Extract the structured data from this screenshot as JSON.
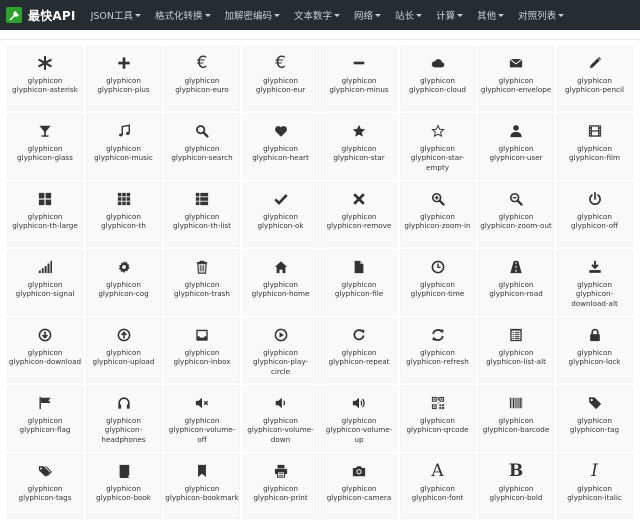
{
  "brand": {
    "title": "最快API"
  },
  "nav": [
    {
      "label": "JSON工具",
      "dropdown": true
    },
    {
      "label": "格式化转换",
      "dropdown": true
    },
    {
      "label": "加解密编码",
      "dropdown": true
    },
    {
      "label": "文本数字",
      "dropdown": true
    },
    {
      "label": "网络",
      "dropdown": true
    },
    {
      "label": "站长",
      "dropdown": true
    },
    {
      "label": "计算",
      "dropdown": true
    },
    {
      "label": "其他",
      "dropdown": true
    },
    {
      "label": "对照列表",
      "dropdown": true
    }
  ],
  "icons": [
    {
      "prefix": "glyphicon",
      "name": "glyphicon-asterisk",
      "icon": "asterisk-icon"
    },
    {
      "prefix": "glyphicon",
      "name": "glyphicon-plus",
      "icon": "plus-icon"
    },
    {
      "prefix": "glyphicon",
      "name": "glyphicon-euro",
      "icon": "euro-icon"
    },
    {
      "prefix": "glyphicon",
      "name": "glyphicon-eur",
      "icon": "eur-icon"
    },
    {
      "prefix": "glyphicon",
      "name": "glyphicon-minus",
      "icon": "minus-icon"
    },
    {
      "prefix": "glyphicon",
      "name": "glyphicon-cloud",
      "icon": "cloud-icon"
    },
    {
      "prefix": "glyphicon",
      "name": "glyphicon-envelope",
      "icon": "envelope-icon"
    },
    {
      "prefix": "glyphicon",
      "name": "glyphicon-pencil",
      "icon": "pencil-icon"
    },
    {
      "prefix": "glyphicon",
      "name": "glyphicon-glass",
      "icon": "glass-icon"
    },
    {
      "prefix": "glyphicon",
      "name": "glyphicon-music",
      "icon": "music-icon"
    },
    {
      "prefix": "glyphicon",
      "name": "glyphicon-search",
      "icon": "search-icon"
    },
    {
      "prefix": "glyphicon",
      "name": "glyphicon-heart",
      "icon": "heart-icon"
    },
    {
      "prefix": "glyphicon",
      "name": "glyphicon-star",
      "icon": "star-icon"
    },
    {
      "prefix": "glyphicon",
      "name": "glyphicon-star-empty",
      "icon": "star-empty-icon"
    },
    {
      "prefix": "glyphicon",
      "name": "glyphicon-user",
      "icon": "user-icon"
    },
    {
      "prefix": "glyphicon",
      "name": "glyphicon-film",
      "icon": "film-icon"
    },
    {
      "prefix": "glyphicon",
      "name": "glyphicon-th-large",
      "icon": "th-large-icon"
    },
    {
      "prefix": "glyphicon",
      "name": "glyphicon-th",
      "icon": "th-icon"
    },
    {
      "prefix": "glyphicon",
      "name": "glyphicon-th-list",
      "icon": "th-list-icon"
    },
    {
      "prefix": "glyphicon",
      "name": "glyphicon-ok",
      "icon": "ok-icon"
    },
    {
      "prefix": "glyphicon",
      "name": "glyphicon-remove",
      "icon": "remove-icon"
    },
    {
      "prefix": "glyphicon",
      "name": "glyphicon-zoom-in",
      "icon": "zoom-in-icon"
    },
    {
      "prefix": "glyphicon",
      "name": "glyphicon-zoom-out",
      "icon": "zoom-out-icon"
    },
    {
      "prefix": "glyphicon",
      "name": "glyphicon-off",
      "icon": "off-icon"
    },
    {
      "prefix": "glyphicon",
      "name": "glyphicon-signal",
      "icon": "signal-icon"
    },
    {
      "prefix": "glyphicon",
      "name": "glyphicon-cog",
      "icon": "cog-icon"
    },
    {
      "prefix": "glyphicon",
      "name": "glyphicon-trash",
      "icon": "trash-icon"
    },
    {
      "prefix": "glyphicon",
      "name": "glyphicon-home",
      "icon": "home-icon"
    },
    {
      "prefix": "glyphicon",
      "name": "glyphicon-file",
      "icon": "file-icon"
    },
    {
      "prefix": "glyphicon",
      "name": "glyphicon-time",
      "icon": "time-icon"
    },
    {
      "prefix": "glyphicon",
      "name": "glyphicon-road",
      "icon": "road-icon"
    },
    {
      "prefix": "glyphicon",
      "name": "glyphicon-download-alt",
      "icon": "download-alt-icon"
    },
    {
      "prefix": "glyphicon",
      "name": "glyphicon-download",
      "icon": "download-icon"
    },
    {
      "prefix": "glyphicon",
      "name": "glyphicon-upload",
      "icon": "upload-icon"
    },
    {
      "prefix": "glyphicon",
      "name": "glyphicon-inbox",
      "icon": "inbox-icon"
    },
    {
      "prefix": "glyphicon",
      "name": "glyphicon-play-circle",
      "icon": "play-circle-icon"
    },
    {
      "prefix": "glyphicon",
      "name": "glyphicon-repeat",
      "icon": "repeat-icon"
    },
    {
      "prefix": "glyphicon",
      "name": "glyphicon-refresh",
      "icon": "refresh-icon"
    },
    {
      "prefix": "glyphicon",
      "name": "glyphicon-list-alt",
      "icon": "list-alt-icon"
    },
    {
      "prefix": "glyphicon",
      "name": "glyphicon-lock",
      "icon": "lock-icon"
    },
    {
      "prefix": "glyphicon",
      "name": "glyphicon-flag",
      "icon": "flag-icon"
    },
    {
      "prefix": "glyphicon",
      "name": "glyphicon-headphones",
      "icon": "headphones-icon"
    },
    {
      "prefix": "glyphicon",
      "name": "glyphicon-volume-off",
      "icon": "volume-off-icon"
    },
    {
      "prefix": "glyphicon",
      "name": "glyphicon-volume-down",
      "icon": "volume-down-icon"
    },
    {
      "prefix": "glyphicon",
      "name": "glyphicon-volume-up",
      "icon": "volume-up-icon"
    },
    {
      "prefix": "glyphicon",
      "name": "glyphicon-qrcode",
      "icon": "qrcode-icon"
    },
    {
      "prefix": "glyphicon",
      "name": "glyphicon-barcode",
      "icon": "barcode-icon"
    },
    {
      "prefix": "glyphicon",
      "name": "glyphicon-tag",
      "icon": "tag-icon"
    },
    {
      "prefix": "glyphicon",
      "name": "glyphicon-tags",
      "icon": "tags-icon"
    },
    {
      "prefix": "glyphicon",
      "name": "glyphicon-book",
      "icon": "book-icon"
    },
    {
      "prefix": "glyphicon",
      "name": "glyphicon-bookmark",
      "icon": "bookmark-icon"
    },
    {
      "prefix": "glyphicon",
      "name": "glyphicon-print",
      "icon": "print-icon"
    },
    {
      "prefix": "glyphicon",
      "name": "glyphicon-camera",
      "icon": "camera-icon"
    },
    {
      "prefix": "glyphicon",
      "name": "glyphicon-font",
      "icon": "font-icon"
    },
    {
      "prefix": "glyphicon",
      "name": "glyphicon-bold",
      "icon": "bold-icon"
    },
    {
      "prefix": "glyphicon",
      "name": "glyphicon-italic",
      "icon": "italic-icon"
    }
  ],
  "colors": {
    "navbar": "#252d33",
    "brand_logo": "#2aa52a",
    "cell_bg": "#f9f9f9",
    "text": "#333333"
  }
}
